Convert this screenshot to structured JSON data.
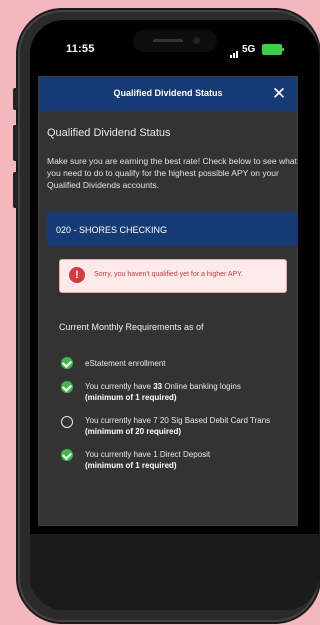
{
  "status_bar": {
    "time": "11:55",
    "network": "5G"
  },
  "modal": {
    "header_title": "Qualified Dividend Status",
    "close_label": "✕",
    "subtitle": "Qualified Dividend Status",
    "description": "Make sure you are earning the best rate! Check below to see what you need to do to qualify for the highest possible APY on your Qualified Dividends accounts.",
    "account": "020 - SHORES CHECKING",
    "alert": {
      "icon": "!",
      "text": "Sorry, you haven't qualified yet for a higher APY."
    },
    "requirements_heading": "Current Monthly Requirements as of",
    "requirements": [
      {
        "status": "met",
        "icon": "check-circle-icon",
        "text": "eStatement enrollment",
        "detail": ""
      },
      {
        "status": "met",
        "icon": "check-circle-icon",
        "text_pre": "You currently have ",
        "count": "33",
        "text_post": " Online banking logins",
        "detail": "(minimum of 1 required)"
      },
      {
        "status": "pending",
        "icon": "empty-circle-icon",
        "text_pre": "You currently have 7 20 Sig Based Debit Card Trans ",
        "detail": "(minimum of 20 required)"
      },
      {
        "status": "met",
        "icon": "check-circle-icon",
        "text_pre": "You currently have 1 Direct Deposit",
        "detail": "(minimum of 1 required)"
      }
    ]
  },
  "colors": {
    "header": "#163a73",
    "background": "#f4b7bd",
    "success": "#3fb84b",
    "error": "#d43a3f"
  }
}
